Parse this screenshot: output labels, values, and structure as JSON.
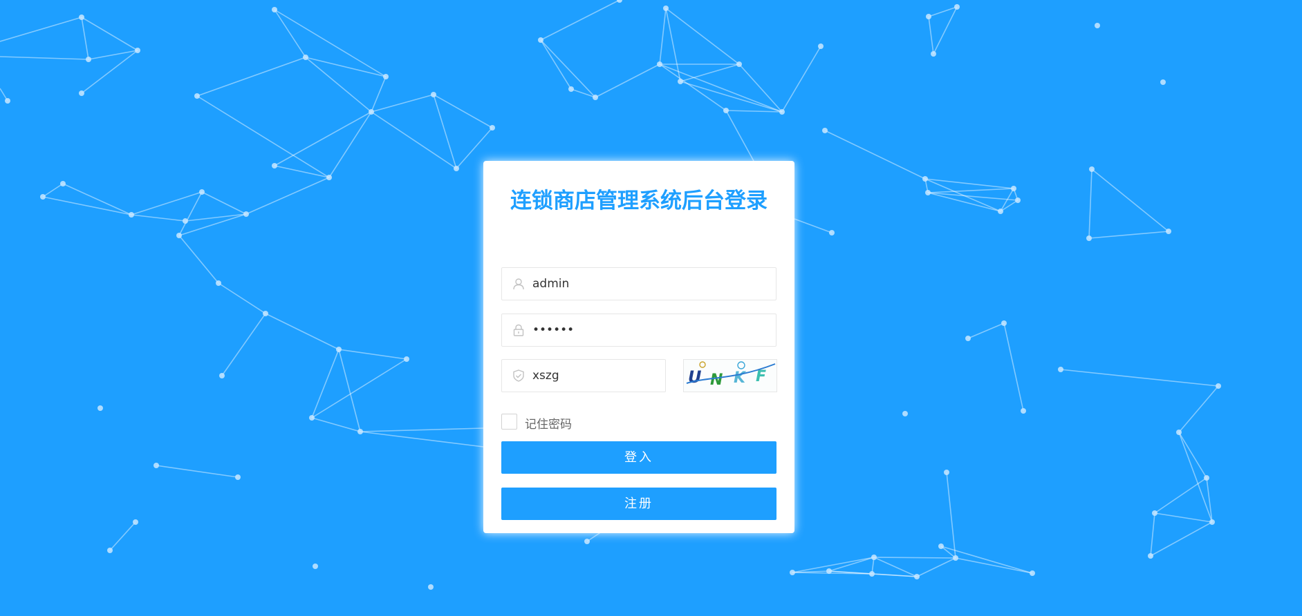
{
  "login": {
    "title": "连锁商店管理系统后台登录",
    "username": {
      "value": "admin",
      "icon": "user-icon"
    },
    "password": {
      "value": "123456",
      "icon": "lock-icon"
    },
    "captcha_input": {
      "value": "xszg",
      "icon": "shield-icon"
    },
    "captcha_image": {
      "text": "UNKF",
      "chars": [
        "U",
        "N",
        "K",
        "F"
      ]
    },
    "remember": {
      "label": "记住密码",
      "checked": false
    },
    "login_button": "登入",
    "register_button": "注册"
  },
  "colors": {
    "background": "#1e9fff",
    "accent": "#1e9fff",
    "card": "#ffffff"
  }
}
